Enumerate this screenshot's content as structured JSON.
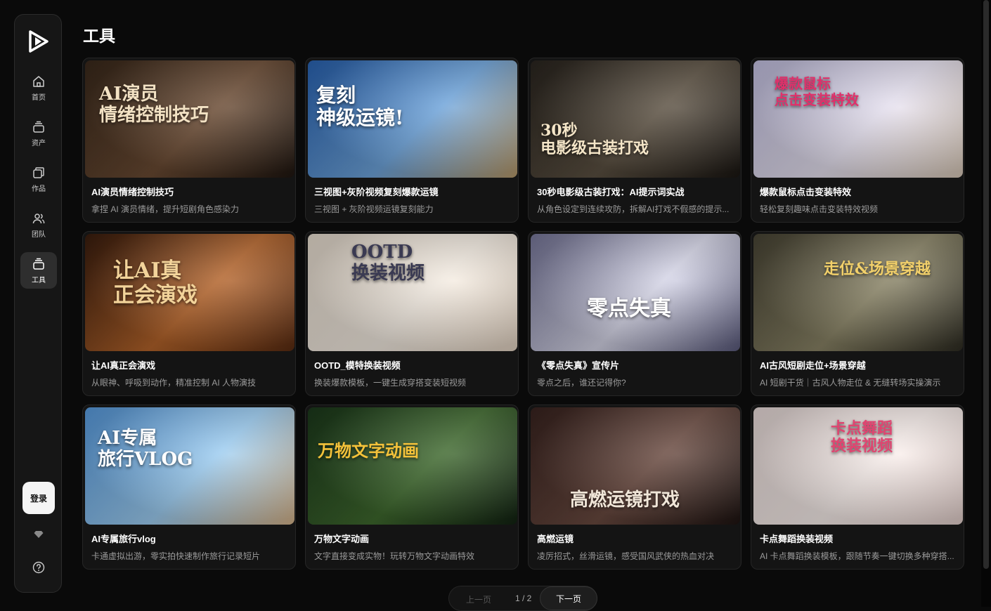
{
  "sidebar": {
    "items": [
      {
        "label": "首页",
        "icon": "home-icon"
      },
      {
        "label": "资产",
        "icon": "layers-icon"
      },
      {
        "label": "作品",
        "icon": "folder-icon"
      },
      {
        "label": "团队",
        "icon": "users-icon"
      },
      {
        "label": "工具",
        "icon": "tools-icon",
        "active": true
      }
    ],
    "login_label": "登录"
  },
  "page": {
    "title": "工具"
  },
  "cards": [
    {
      "title": "AI演员情绪控制技巧",
      "desc": "拿捏 AI 演员情绪，提升短剧角色感染力",
      "overlay": "AI演员\n情绪控制技巧",
      "bg": [
        "#3b2a1c",
        "#6b4b33",
        "#1f1610"
      ]
    },
    {
      "title": "三视图+灰阶视频复刻爆款运镜",
      "desc": "三视图 + 灰阶视频运镜复刻能力",
      "overlay": "复刻\n神级运镜!",
      "bg": [
        "#2a66b8",
        "#6fa6de",
        "#b89a6a"
      ]
    },
    {
      "title": "30秒电影级古装打戏：AI提示词实战",
      "desc": "从角色设定到连续攻防，拆解AI打戏不假感的提示...",
      "overlay": "30秒\n电影级古装打戏",
      "bg": [
        "#2b2620",
        "#5c5142",
        "#1a1612"
      ]
    },
    {
      "title": "爆款鼠标点击变装特效",
      "desc": "轻松复刻趣味点击变装特效视频",
      "overlay": "爆款鼠标\n点击变装特效",
      "bg": [
        "#c9c6e8",
        "#e8e3f2",
        "#d9c9b8"
      ]
    },
    {
      "title": "让AI真正会演戏",
      "desc": "从眼神、呼吸到动作，精准控制 AI 人物演技",
      "overlay": "让AI真\n正会演戏",
      "bg": [
        "#3a1d0e",
        "#b5642a",
        "#5a2c12"
      ]
    },
    {
      "title": "OOTD_模特换装视频",
      "desc": "换装爆款模板，一键生成穿搭变装短视频",
      "overlay": "OOTD\n换装视频",
      "bg": [
        "#efe4d6",
        "#f6eee4",
        "#e3d3c2"
      ]
    },
    {
      "title": "《零点失真》宣传片",
      "desc": "零点之后，谁还记得你?",
      "overlay": "零点失真",
      "bg": [
        "#7a7a9e",
        "#d8d8ea",
        "#5a5a7c"
      ]
    },
    {
      "title": "AI古风短剧走位+场景穿越",
      "desc": "AI 短剧干货｜古风人物走位 & 无缝转场实操演示",
      "overlay": "走位&场景穿越",
      "bg": [
        "#4a4636",
        "#8a8466",
        "#2e2c22"
      ]
    },
    {
      "title": "AI专属旅行vlog",
      "desc": "卡通虚拟出游，零实拍快速制作旅行记录短片",
      "overlay": "AI专属\n旅行VLOG",
      "bg": [
        "#5aa0e6",
        "#9fd0f5",
        "#d6b48a"
      ]
    },
    {
      "title": "万物文字动画",
      "desc": "文字直接变成实物！玩转万物文字动画特效",
      "overlay": "万物文字动画",
      "bg": [
        "#1c3a1c",
        "#3f6a2e",
        "#122212"
      ]
    },
    {
      "title": "高燃运镜",
      "desc": "凌厉招式，丝滑运镜，感受国风武侠的热血对决",
      "overlay": "高燃运镜打戏",
      "bg": [
        "#3a2420",
        "#6a4a40",
        "#1e1412"
      ]
    },
    {
      "title": "卡点舞蹈换装视频",
      "desc": "AI 卡点舞蹈换装模板，跟随节奏一键切换多种穿搭...",
      "overlay": "卡点舞蹈\n换装视频",
      "bg": [
        "#f0e2e0",
        "#fbf1ee",
        "#e4d0cc"
      ]
    }
  ],
  "pagination": {
    "prev_label": "上一页",
    "count": "1 / 2",
    "next_label": "下一页"
  },
  "colors": {
    "accent_active": "#2e2e2e",
    "background": "#0a0a0a",
    "card_bg": "#141414"
  }
}
